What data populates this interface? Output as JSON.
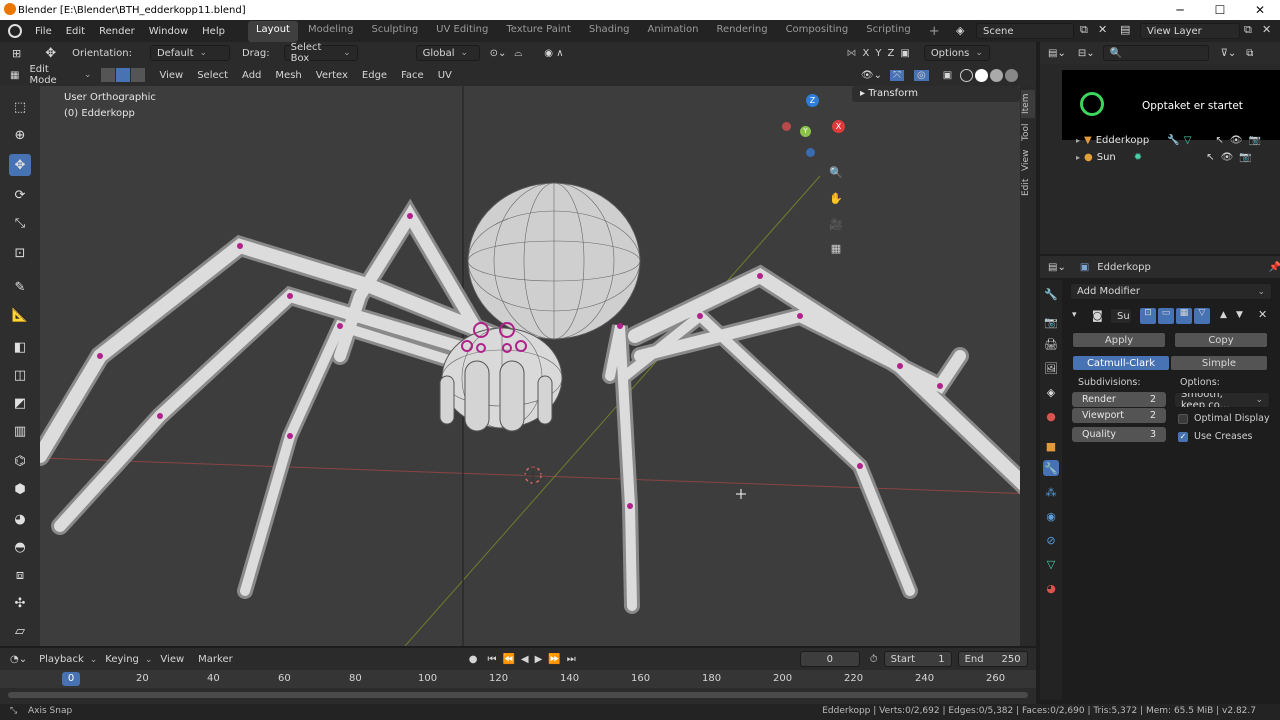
{
  "window": {
    "title": "Blender [E:\\Blender\\BTH_edderkopp11.blend]",
    "min": "─",
    "max": "☐",
    "close": "✕"
  },
  "menu": [
    "File",
    "Edit",
    "Render",
    "Window",
    "Help"
  ],
  "workspaces": [
    "Layout",
    "Modeling",
    "Sculpting",
    "UV Editing",
    "Texture Paint",
    "Shading",
    "Animation",
    "Rendering",
    "Compositing",
    "Scripting"
  ],
  "workspace_add": "+",
  "scene": "Scene",
  "view_layer": "View Layer",
  "toolheader": {
    "orientation_label": "Orientation:",
    "orientation": "Default",
    "drag_label": "Drag:",
    "drag": "Select Box",
    "transform": "Global",
    "options": "Options"
  },
  "modeheader": {
    "mode": "Edit Mode",
    "items": [
      "View",
      "Select",
      "Add",
      "Mesh",
      "Vertex",
      "Edge",
      "Face",
      "UV"
    ]
  },
  "viewport": {
    "view_name": "User Orthographic",
    "object": "(0) Edderkopp",
    "transform_panel": "Transform",
    "gizmo": {
      "x": "X",
      "y": "Y",
      "z": "Z"
    }
  },
  "sidetabs": [
    "Item",
    "Tool",
    "View",
    "Edit"
  ],
  "notification": "Opptaket er startet",
  "outliner": {
    "items": [
      {
        "name": "Edderkopp"
      },
      {
        "name": "Sun"
      }
    ]
  },
  "properties": {
    "object": "Edderkopp",
    "add_modifier": "Add Modifier",
    "modifier_name": "Su",
    "apply": "Apply",
    "copy": "Copy",
    "catmull": "Catmull-Clark",
    "simple": "Simple",
    "subdiv_label": "Subdivisions:",
    "options_label": "Options:",
    "render_label": "Render",
    "render_val": "2",
    "viewport_label": "Viewport",
    "viewport_val": "2",
    "quality_label": "Quality",
    "quality_val": "3",
    "uv_smooth": "Smooth, keep co...",
    "optimal_display": "Optimal Display",
    "optimal_checked": false,
    "use_creases": "Use Creases",
    "creases_checked": true
  },
  "timeline": {
    "menus": [
      "Playback",
      "Keying",
      "View",
      "Marker"
    ],
    "current": "0",
    "start_label": "Start",
    "start": "1",
    "end_label": "End",
    "end": "250",
    "ticks": [
      "0",
      "20",
      "40",
      "60",
      "80",
      "100",
      "120",
      "140",
      "160",
      "180",
      "200",
      "220",
      "240",
      "260"
    ]
  },
  "status": {
    "left": "Axis Snap",
    "right": "Edderkopp | Verts:0/2,692 | Edges:0/5,382 | Faces:0/2,690 | Tris:5,372 | Mem: 65.5 MiB | v2.82.7"
  }
}
